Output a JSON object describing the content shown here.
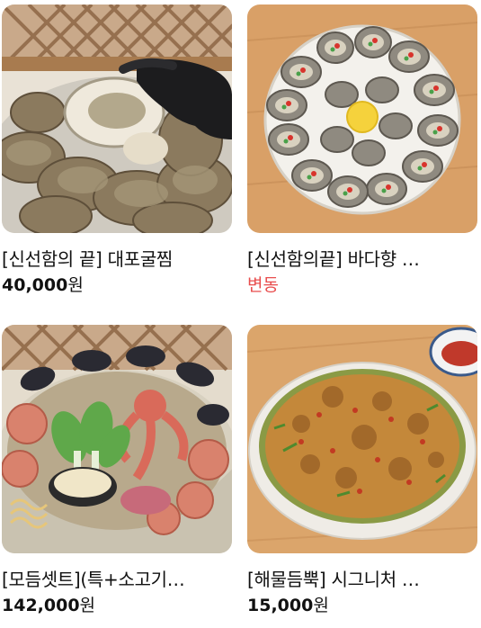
{
  "products": [
    {
      "name": "[신선함의 끝] 대포굴찜",
      "price": "40,000",
      "unit": "원",
      "image_icon": "steamed-oysters-photo"
    },
    {
      "name": "[신선함의끝] 바다향 …",
      "price_variable": "변동",
      "image_icon": "raw-oyster-platter-photo",
      "price_color": "#e84d4d"
    },
    {
      "name": "[모듬셋트](특+소고기…",
      "price": "142,000",
      "unit": "원",
      "image_icon": "seafood-steamer-set-photo"
    },
    {
      "name": "[해물듬뿍] 시그니처 …",
      "price": "15,000",
      "unit": "원",
      "image_icon": "seafood-pancake-photo"
    }
  ]
}
